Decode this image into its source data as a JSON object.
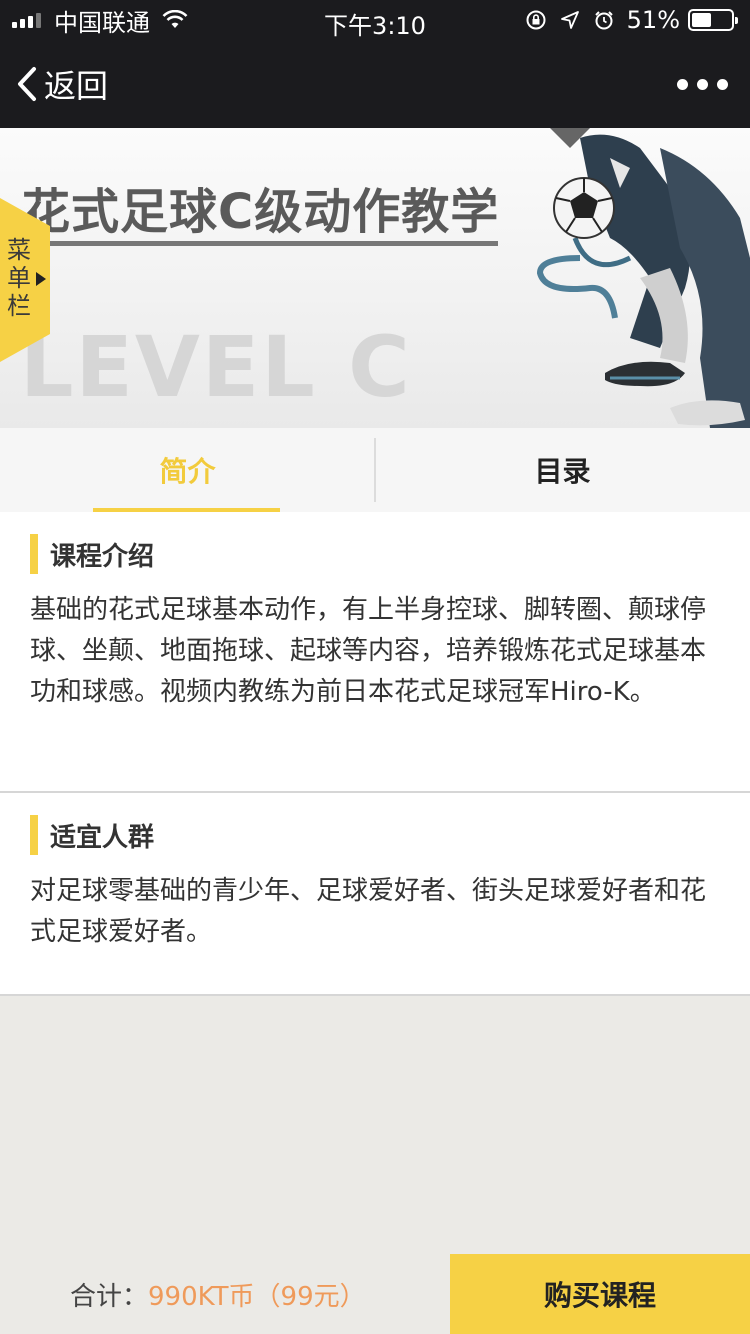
{
  "status_bar": {
    "carrier": "中国联通",
    "time": "下午3:10",
    "battery_percent": "51%",
    "battery_level": 0.51,
    "icons": [
      "signal-icon",
      "wifi-icon",
      "rotation-lock-icon",
      "location-icon",
      "alarm-icon",
      "battery-icon"
    ]
  },
  "nav": {
    "back_label": "返回",
    "more_icon": "more-dots-icon"
  },
  "banner": {
    "title": "花式足球C级动作教学",
    "subtitle": "LEVEL C",
    "menu_label": "菜单栏"
  },
  "tabs": [
    {
      "label": "简介",
      "active": true
    },
    {
      "label": "目录",
      "active": false
    }
  ],
  "sections": {
    "intro": {
      "title": "课程介绍",
      "body": "基础的花式足球基本动作，有上半身控球、脚转圈、颠球停球、坐颠、地面拖球、起球等内容，培养锻炼花式足球基本功和球感。视频内教练为前日本花式足球冠军Hiro-K。"
    },
    "audience": {
      "title": "适宜人群",
      "body": "对足球零基础的青少年、足球爱好者、街头足球爱好者和花式足球爱好者。"
    }
  },
  "footer": {
    "total_label": "合计：",
    "price": "990KT币（99元）",
    "buy_label": "购买课程"
  },
  "colors": {
    "accent": "#f6d145",
    "price": "#ef9a5a",
    "dark_bar": "#1b1b1e"
  }
}
